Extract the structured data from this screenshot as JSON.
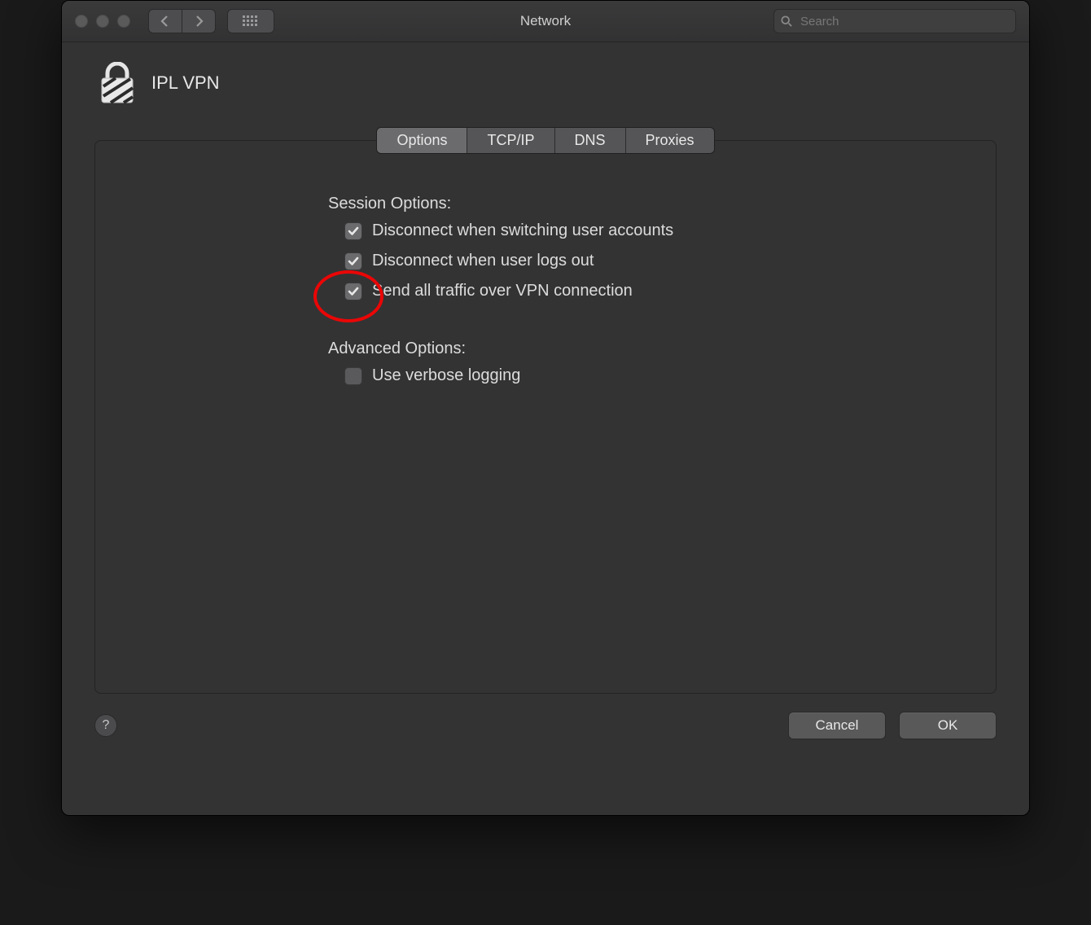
{
  "titlebar": {
    "title": "Network",
    "search_placeholder": "Search"
  },
  "header": {
    "name": "IPL VPN"
  },
  "tabs": [
    {
      "label": "Options",
      "active": true
    },
    {
      "label": "TCP/IP",
      "active": false
    },
    {
      "label": "DNS",
      "active": false
    },
    {
      "label": "Proxies",
      "active": false
    }
  ],
  "session": {
    "title": "Session Options:",
    "items": [
      {
        "label": "Disconnect when switching user accounts",
        "checked": true,
        "highlight": false
      },
      {
        "label": "Disconnect when user logs out",
        "checked": true,
        "highlight": false
      },
      {
        "label": "Send all traffic over VPN connection",
        "checked": true,
        "highlight": true
      }
    ]
  },
  "advanced": {
    "title": "Advanced Options:",
    "items": [
      {
        "label": "Use verbose logging",
        "checked": false,
        "highlight": false
      }
    ]
  },
  "footer": {
    "help": "?",
    "cancel": "Cancel",
    "ok": "OK"
  }
}
